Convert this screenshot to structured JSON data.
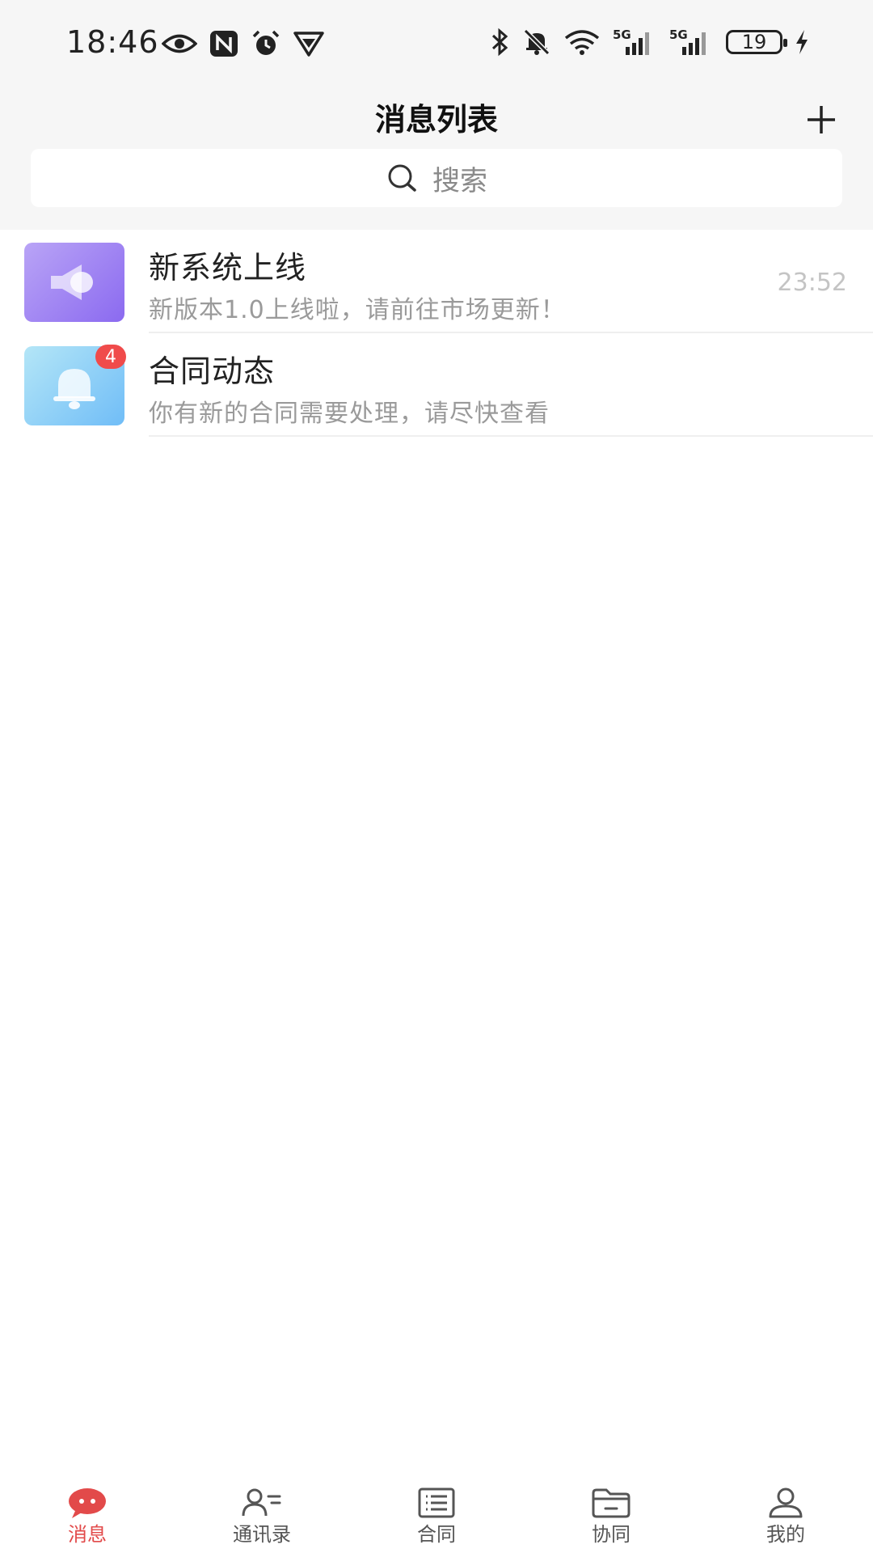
{
  "status_bar": {
    "time": "18:46",
    "battery": "19",
    "icons_left": [
      "eye-icon",
      "nfc-icon",
      "alarm-icon",
      "shield-icon"
    ],
    "icons_right": [
      "bluetooth-icon",
      "bell-muted-icon",
      "wifi-icon",
      "signal-5g-icon",
      "signal-5g-icon",
      "battery-icon",
      "charging-icon"
    ],
    "network": "5G"
  },
  "header": {
    "title": "消息列表",
    "add_icon": "plus-icon"
  },
  "search": {
    "placeholder": "搜索",
    "icon": "search-icon"
  },
  "messages": [
    {
      "title": "新系统上线",
      "preview": "新版本1.0上线啦，请前往市场更新！",
      "time": "23:52",
      "avatar_icon": "speaker-icon",
      "avatar_color": "#8b6af0",
      "badge": null
    },
    {
      "title": "合同动态",
      "preview": "你有新的合同需要处理，请尽快查看",
      "time": "",
      "avatar_icon": "bell-icon",
      "avatar_color": "#70bdf7",
      "badge": "4"
    }
  ],
  "bottom_nav": {
    "active_color": "#e24a4a",
    "items": [
      {
        "label": "消息",
        "icon": "message-bubble-icon",
        "active": true
      },
      {
        "label": "通讯录",
        "icon": "contacts-icon",
        "active": false
      },
      {
        "label": "合同",
        "icon": "contract-list-icon",
        "active": false
      },
      {
        "label": "协同",
        "icon": "folder-icon",
        "active": false
      },
      {
        "label": "我的",
        "icon": "profile-icon",
        "active": false
      }
    ]
  }
}
